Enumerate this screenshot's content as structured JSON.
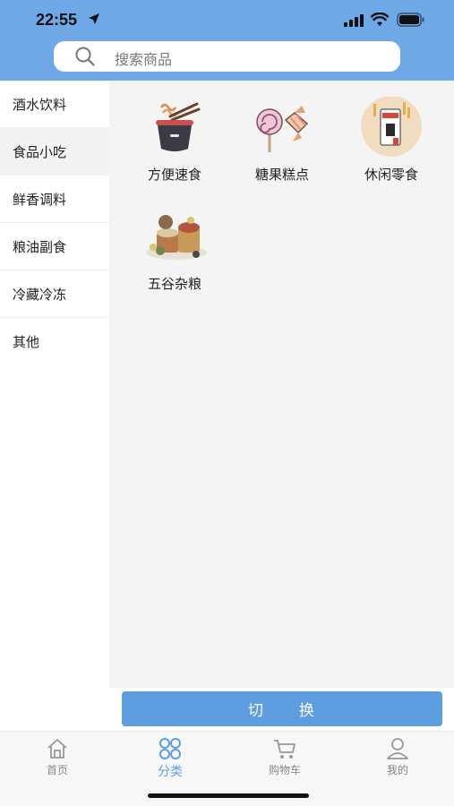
{
  "status_bar": {
    "time": "22:55"
  },
  "search": {
    "placeholder": "搜索商品"
  },
  "sidebar": {
    "items": [
      {
        "label": "酒水饮料"
      },
      {
        "label": "食品小吃",
        "active": true
      },
      {
        "label": "鲜香调料"
      },
      {
        "label": "粮油副食"
      },
      {
        "label": "冷藏冷冻"
      },
      {
        "label": "其他"
      }
    ]
  },
  "categories": [
    {
      "label": "方便速食",
      "icon": "instant-noodle-icon"
    },
    {
      "label": "糖果糕点",
      "icon": "candy-icon"
    },
    {
      "label": "休闲零食",
      "icon": "snack-icon"
    },
    {
      "label": "五谷杂粮",
      "icon": "grains-icon"
    }
  ],
  "switch_button": {
    "label": "切　　换"
  },
  "tabbar": {
    "items": [
      {
        "label": "首页",
        "icon": "home-icon"
      },
      {
        "label": "分类",
        "icon": "category-icon",
        "active": true
      },
      {
        "label": "购物车",
        "icon": "cart-icon"
      },
      {
        "label": "我的",
        "icon": "user-icon"
      }
    ]
  },
  "colors": {
    "header": "#6ea8e6",
    "accent": "#5c9ee0",
    "content_bg": "#f4f4f4"
  }
}
